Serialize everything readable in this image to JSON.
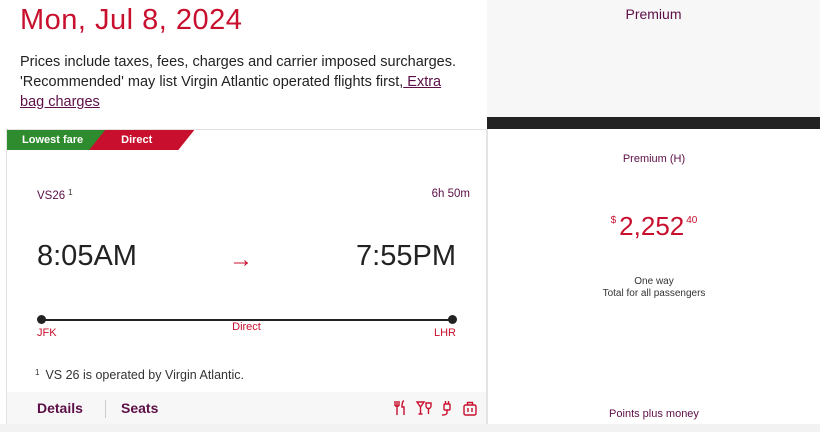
{
  "header": {
    "date": "Mon, Jul 8, 2024",
    "info_text": "Prices include taxes, fees, charges and carrier imposed surcharges. 'Recommended' may list Virgin Atlantic operated flights first,",
    "extra_bag_link": " Extra bag charges"
  },
  "cabin_header": {
    "title": "Premium"
  },
  "flight": {
    "badges": {
      "lowest_fare": "Lowest fare",
      "direct": "Direct"
    },
    "flight_number": "VS26",
    "flight_note_marker": "1",
    "duration": "6h 50m",
    "departure_time": "8:05AM",
    "arrival_time": "7:55PM",
    "arrow": "→",
    "origin": "JFK",
    "destination": "LHR",
    "stops": "Direct",
    "operator_note_marker": "1",
    "operator_note": "VS 26 is operated by Virgin Atlantic.",
    "footer": {
      "details_label": "Details",
      "seats_label": "Seats"
    },
    "amenity_icons": [
      "meal-icon",
      "drink-icon",
      "power-icon",
      "bag-icon"
    ]
  },
  "fare": {
    "class_label": "Premium (H)",
    "currency": "$",
    "price_whole": "2,252",
    "price_cents": "40",
    "trip_type": "One way",
    "passenger_note": "Total for all passengers",
    "points_money_label": "Points plus money"
  },
  "colors": {
    "brand_red": "#c8102e",
    "brand_purple": "#5c0f47",
    "badge_green": "#2e8b2e",
    "dark_bar": "#222222"
  }
}
